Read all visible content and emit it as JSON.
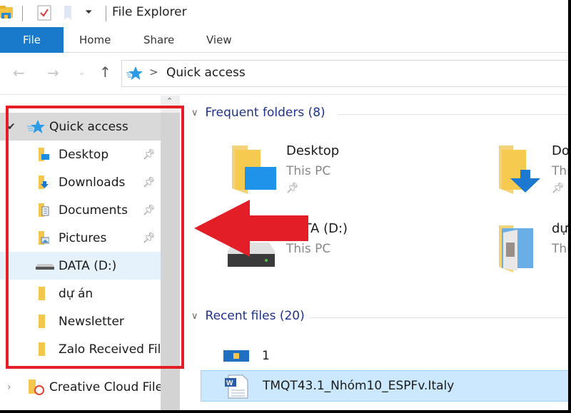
{
  "window": {
    "title": "File Explorer"
  },
  "ribbon": {
    "tabs": [
      {
        "label": "File",
        "active": true
      },
      {
        "label": "Home"
      },
      {
        "label": "Share"
      },
      {
        "label": "View"
      }
    ]
  },
  "navigation": {
    "back_icon": "arrow-left-icon",
    "forward_icon": "arrow-right-icon",
    "recent_icon": "chevron-down-icon",
    "up_icon": "arrow-up-icon",
    "address": {
      "icon": "quick-access-star-icon",
      "separator": ">",
      "path": "Quick access"
    }
  },
  "sidebar": {
    "root": {
      "label": "Quick access",
      "expanded": true,
      "selected": true
    },
    "items": [
      {
        "label": "Desktop",
        "icon": "desktop-folder-icon",
        "pinned": true
      },
      {
        "label": "Downloads",
        "icon": "downloads-folder-icon",
        "pinned": true
      },
      {
        "label": "Documents",
        "icon": "documents-folder-icon",
        "pinned": true
      },
      {
        "label": "Pictures",
        "icon": "pictures-folder-icon",
        "pinned": true
      },
      {
        "label": "DATA (D:)",
        "icon": "drive-icon",
        "pinned": false,
        "hover": true
      },
      {
        "label": "dự án",
        "icon": "folder-icon",
        "pinned": false
      },
      {
        "label": "Newsletter",
        "icon": "folder-icon",
        "pinned": false
      },
      {
        "label": "Zalo Received Fil",
        "icon": "folder-icon",
        "pinned": false
      }
    ],
    "creative_cloud": {
      "label": "Creative Cloud File",
      "expanded": false
    }
  },
  "content": {
    "frequent": {
      "header": "Frequent folders (8)",
      "tiles": [
        {
          "name": "Desktop",
          "location": "This PC",
          "pinned": true
        },
        {
          "name": "Do",
          "location": "Thi",
          "pinned": true
        },
        {
          "name": "DATA (D:)",
          "location": "This PC",
          "pinned": false
        },
        {
          "name": "dự",
          "location": "Thi",
          "pinned": false
        }
      ]
    },
    "recent": {
      "header": "Recent files (20)",
      "files": [
        {
          "name": "1",
          "icon": "image-file-icon",
          "selected": false
        },
        {
          "name": "TMQT43.1_Nhóm10_ESPFv.Italy",
          "icon": "word-document-icon",
          "selected": true
        }
      ]
    }
  },
  "annotation": {
    "highlight_color": "#e31e26",
    "arrow_direction": "left"
  }
}
